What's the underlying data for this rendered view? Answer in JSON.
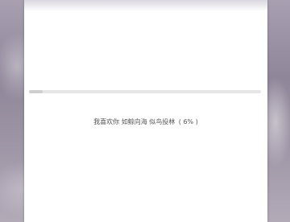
{
  "loading": {
    "message": "我喜欢你 如鲸向海 似鸟投林",
    "percent_text": "( 6% )",
    "progress": 0.06
  },
  "colors": {
    "panel": "#ffffff",
    "track": "#e6e6e6",
    "fill": "#cfcfcf",
    "text": "#555555"
  }
}
